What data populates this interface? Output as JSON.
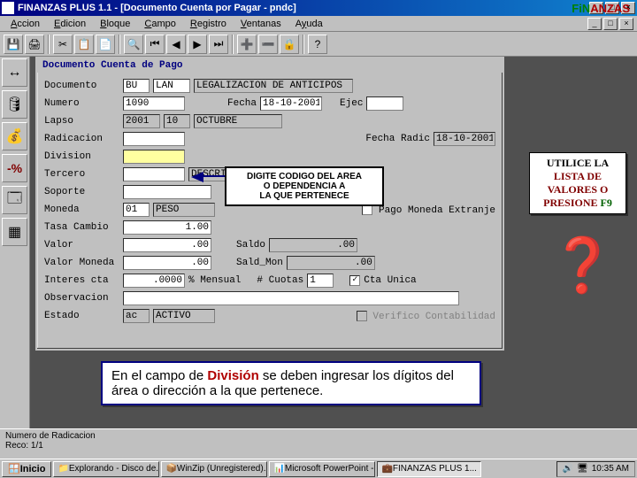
{
  "window": {
    "title": "FINANZAS PLUS 1.1 - [Documento Cuenta por Pagar - pndc]"
  },
  "menu": {
    "accion": "Accion",
    "edicion": "Edicion",
    "bloque": "Bloque",
    "campo": "Campo",
    "registro": "Registro",
    "ventanas": "Ventanas",
    "ayuda": "Ayuda"
  },
  "brand": {
    "text_a": "FiN",
    "text_b": "ANZAS"
  },
  "form": {
    "title": "Documento Cuenta de Pago",
    "labels": {
      "documento": "Documento",
      "numero": "Numero",
      "lapso": "Lapso",
      "radicacion": "Radicacion",
      "division": "Division",
      "tercero": "Tercero",
      "soporte": "Soporte",
      "moneda": "Moneda",
      "tasa_cambio": "Tasa Cambio",
      "valor": "Valor",
      "valor_moneda": "Valor Moneda",
      "interes_cta": "Interes cta",
      "observacion": "Observacion",
      "estado": "Estado",
      "fecha": "Fecha",
      "ejec": "Ejec",
      "fecha_radic": "Fecha Radic",
      "pago_moneda": "Pago Moneda Extranje",
      "saldo": "Saldo",
      "sald_mon": "Sald_Mon",
      "mensual": "% Mensual",
      "cuotas": "# Cuotas",
      "cta_unica": "Cta Unica",
      "verifico": "Verifico Contabilidad"
    },
    "values": {
      "doc_a": "BU",
      "doc_b": "LAN",
      "doc_desc": "LEGALIZACION DE ANTICIPOS",
      "numero": "1090",
      "fecha": "18-10-2001",
      "ejec": "",
      "lapso_a": "2001",
      "lapso_b": "10",
      "lapso_desc": "OCTUBRE",
      "radicacion": "",
      "fecha_radic": "18-10-2001",
      "division": "",
      "tercero": "",
      "tercero_desc": "DESCRIPCION",
      "soporte": "",
      "moneda_cod": "01",
      "moneda_desc": "PESO",
      "tasa": "1.00",
      "valor": ".00",
      "saldo": ".00",
      "valor_mon": ".00",
      "sald_mon": ".00",
      "interes": ".0000",
      "mensual": "",
      "cuotas": "1",
      "observacion": "",
      "estado_cod": "ac",
      "estado_desc": "ACTIVO"
    }
  },
  "callout": {
    "line1": "DIGITE CODIGO DEL AREA",
    "line2": "O DEPENDENCIA A",
    "line3": "LA QUE PERTENECE"
  },
  "hint": {
    "l1": "UTILICE LA",
    "l2": "LISTA DE",
    "l3": "VALORES O",
    "l4a": "PRESIONE ",
    "l4b": "F9"
  },
  "instruction": {
    "pre": "En el campo de  ",
    "kw": "División",
    "post": " se deben ingresar los dígitos del área o dirección a la que pertenece."
  },
  "status": {
    "l1": "Numero de Radicacion",
    "l2": "Reco: 1/1"
  },
  "taskbar": {
    "start": "Inicio",
    "t1": "Explorando - Disco de...",
    "t2": "WinZip (Unregistered)...",
    "t3": "Microsoft PowerPoint -...",
    "t4": "FINANZAS PLUS 1...",
    "clock": "10:35 AM"
  }
}
